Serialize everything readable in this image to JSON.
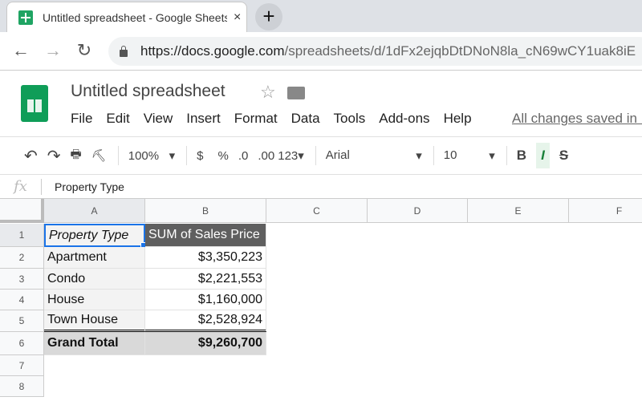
{
  "browser": {
    "tab_title": "Untitled spreadsheet - Google Sheets",
    "close": "×",
    "new_tab": "+",
    "back": "←",
    "forward": "→",
    "reload": "↻",
    "url_host": "https://docs.google.com",
    "url_path": "/spreadsheets/d/1dFx2ejqbDtDNoN8la_cN69wCY1uak8iE"
  },
  "app": {
    "title": "Untitled spreadsheet",
    "star": "☆",
    "menu": [
      "File",
      "Edit",
      "View",
      "Insert",
      "Format",
      "Data",
      "Tools",
      "Add-ons",
      "Help"
    ],
    "saved_status": "All changes saved in Drive"
  },
  "toolbar": {
    "undo": "↶",
    "redo": "↷",
    "print": "🖶",
    "paint": "⛏",
    "zoom": "100%",
    "currency": "$",
    "percent": "%",
    "dec_less": ".0",
    "dec_more": ".00",
    "format": "123",
    "font": "Arial",
    "size": "10",
    "bold": "B",
    "italic": "I",
    "strike": "S",
    "dropdown": "▾"
  },
  "formula_bar": {
    "fx": "fx",
    "value": "Property Type"
  },
  "columns": [
    "A",
    "B",
    "C",
    "D",
    "E",
    "F"
  ],
  "rows": [
    "1",
    "2",
    "3",
    "4",
    "5",
    "6",
    "7",
    "8"
  ],
  "pivot": {
    "header": [
      "Property Type",
      "SUM of Sales Price"
    ],
    "data": [
      [
        "Apartment",
        "$3,350,223"
      ],
      [
        "Condo",
        "$2,221,553"
      ],
      [
        "House",
        "$1,160,000"
      ],
      [
        "Town House",
        "$2,528,924"
      ]
    ],
    "total": [
      "Grand Total",
      "$9,260,700"
    ]
  },
  "colors": {
    "header_bg": "#5f5f5f",
    "total_bg": "#d9d9d9",
    "label_bg": "#f3f3f3",
    "selection": "#1a73e8",
    "brand": "#0f9d58"
  }
}
